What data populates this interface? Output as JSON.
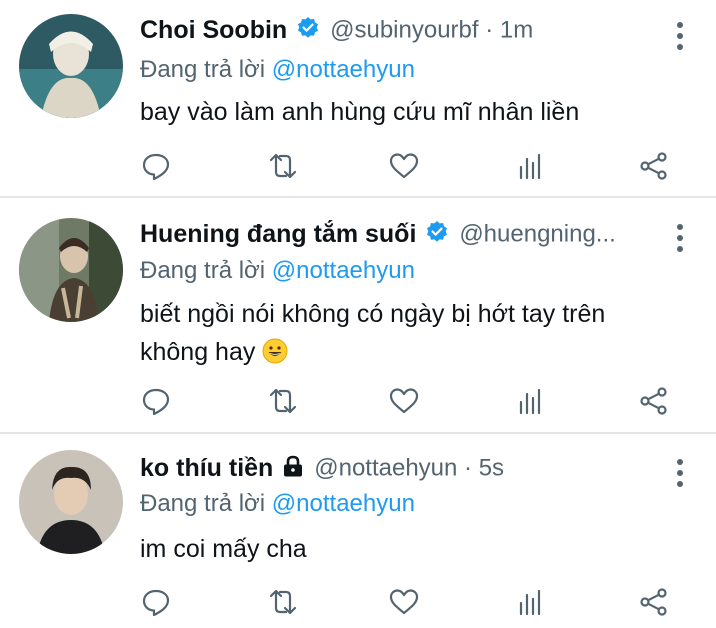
{
  "tweets": [
    {
      "name": "Choi Soobin",
      "verified": true,
      "locked": false,
      "handle_line": "@subinyourbf · 1m",
      "reply_prefix": "Đang trả lời",
      "reply_to": "@nottaehyun",
      "text_lines": [
        "bay vào làm anh hùng cứu mĩ nhân liền"
      ]
    },
    {
      "name": "Huening đang tắm suối",
      "verified": true,
      "locked": false,
      "handle_line": "@huengning...",
      "reply_prefix": "Đang trả lời",
      "reply_to": "@nottaehyun",
      "text_lines": [
        "biết ngồi nói không có ngày bị hớt tay trên",
        "không hay"
      ],
      "emoji": "😀"
    },
    {
      "name": "ko thíu tiền",
      "verified": false,
      "locked": true,
      "handle_line": "@nottaehyun · 5s",
      "reply_prefix": "Đang trả lời",
      "reply_to": "@nottaehyun",
      "text_lines": [
        "im coi mấy cha"
      ]
    }
  ],
  "colors": {
    "accent": "#1d9bf0",
    "secondary_text": "#536471",
    "primary_text": "#0f1419",
    "divider": "#e3e6e8"
  },
  "icons": [
    "verified-badge-icon",
    "lock-icon",
    "more-options-icon",
    "reply-icon",
    "retweet-icon",
    "like-icon",
    "views-icon",
    "share-icon"
  ]
}
